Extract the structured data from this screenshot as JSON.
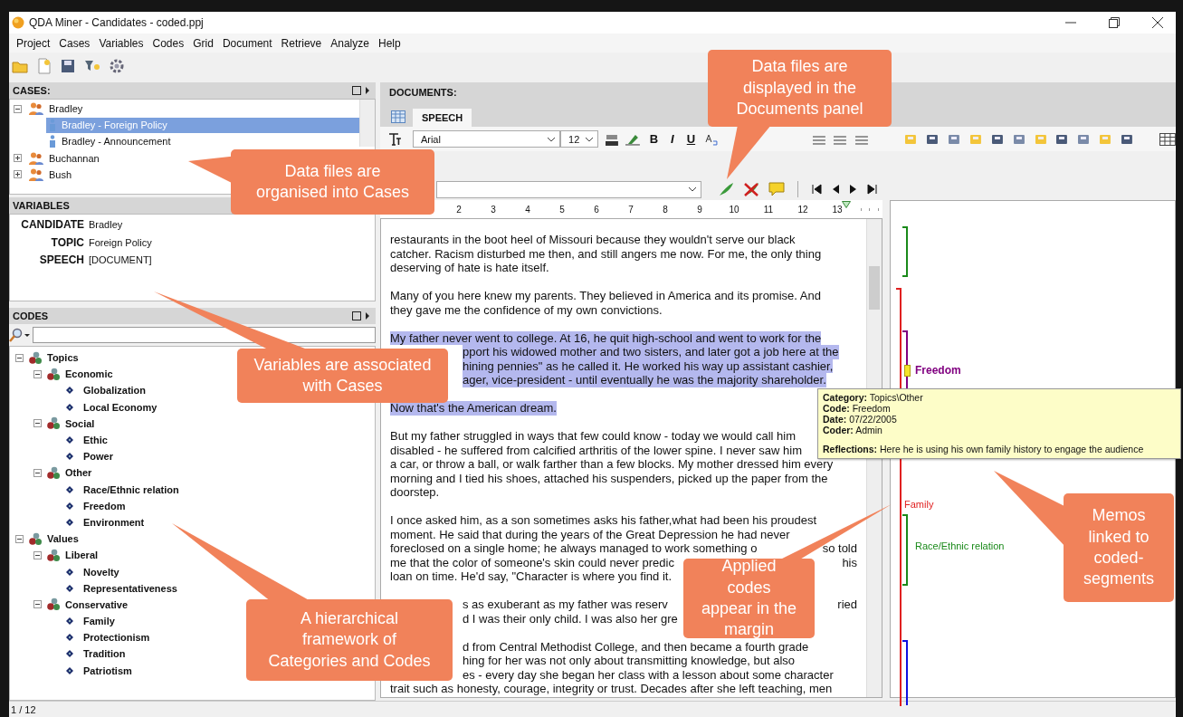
{
  "window": {
    "title": "QDA Miner - Candidates - coded.ppj"
  },
  "menu": [
    "Project",
    "Cases",
    "Variables",
    "Codes",
    "Grid",
    "Document",
    "Retrieve",
    "Analyze",
    "Help"
  ],
  "cases": {
    "title": "CASES:",
    "items": [
      {
        "label": "Bradley",
        "kind": "group",
        "expanded": true,
        "selected": false,
        "children": [
          {
            "label": "Bradley - Foreign Policy",
            "kind": "case",
            "selected": true
          },
          {
            "label": "Bradley - Announcement",
            "kind": "case",
            "selected": false
          }
        ]
      },
      {
        "label": "Buchannan",
        "kind": "group",
        "expanded": false,
        "selected": false
      },
      {
        "label": "Bush",
        "kind": "group",
        "expanded": false,
        "selected": false
      }
    ]
  },
  "variables": {
    "title": "VARIABLES",
    "rows": [
      {
        "name": "CANDIDATE",
        "value": "Bradley"
      },
      {
        "name": "TOPIC",
        "value": "Foreign Policy"
      },
      {
        "name": "SPEECH",
        "value": "[DOCUMENT]"
      }
    ]
  },
  "codes": {
    "title": "CODES",
    "items": [
      {
        "label": "Topics",
        "kind": "category",
        "expanded": true,
        "children": [
          {
            "label": "Economic",
            "kind": "category",
            "expanded": true,
            "children": [
              {
                "label": "Globalization",
                "kind": "code"
              },
              {
                "label": "Local Economy",
                "kind": "code"
              }
            ]
          },
          {
            "label": "Social",
            "kind": "category",
            "expanded": true,
            "children": [
              {
                "label": "Ethic",
                "kind": "code"
              },
              {
                "label": "Power",
                "kind": "code"
              }
            ]
          },
          {
            "label": "Other",
            "kind": "category",
            "expanded": true,
            "children": [
              {
                "label": "Race/Ethnic relation",
                "kind": "code"
              },
              {
                "label": "Freedom",
                "kind": "code"
              },
              {
                "label": "Environment",
                "kind": "code"
              }
            ]
          }
        ]
      },
      {
        "label": "Values",
        "kind": "category",
        "expanded": true,
        "children": [
          {
            "label": "Liberal",
            "kind": "category",
            "expanded": true,
            "children": [
              {
                "label": "Novelty",
                "kind": "code"
              },
              {
                "label": "Representativeness",
                "kind": "code"
              }
            ]
          },
          {
            "label": "Conservative",
            "kind": "category",
            "expanded": true,
            "children": [
              {
                "label": "Family",
                "kind": "code"
              },
              {
                "label": "Protectionism",
                "kind": "code"
              },
              {
                "label": "Tradition",
                "kind": "code"
              },
              {
                "label": "Patriotism",
                "kind": "code"
              }
            ]
          }
        ]
      }
    ]
  },
  "documents": {
    "title": "DOCUMENTS:",
    "tabs": [
      {
        "label": "SPEECH",
        "selected": true
      }
    ],
    "font": "Arial",
    "size": "12",
    "format_buttons": [
      "B",
      "I",
      "U"
    ],
    "ruler": [
      "2",
      "3",
      "4",
      "5",
      "6",
      "7",
      "8",
      "9",
      "10",
      "11",
      "12",
      "13"
    ],
    "paragraphs": [
      {
        "highlighted": false,
        "lines": [
          {
            "kind": "full",
            "parts": [
              "restaurants in the boot heel of Missouri because they wouldn't serve our black"
            ]
          },
          {
            "kind": "full",
            "parts": [
              "catcher. Racism disturbed me then, and still angers me now. For me, the only thing"
            ]
          },
          {
            "kind": "full",
            "parts": [
              "deserving of hate is hate itself."
            ]
          }
        ]
      },
      {
        "highlighted": false,
        "lines": [
          {
            "kind": "full",
            "parts": [
              "Many of you here knew my parents. They believed in America and its promise. And"
            ]
          },
          {
            "kind": "full",
            "parts": [
              "they gave me the confidence of my own convictions."
            ]
          }
        ]
      },
      {
        "highlighted": true,
        "lines": [
          {
            "kind": "full",
            "parts": [
              "My father never went to college. At 16, he quit high-school and went to work for the"
            ]
          },
          {
            "kind": "covered_left",
            "parts": [
              "pport his widowed mother and two sisters, and later got a job here at the"
            ]
          },
          {
            "kind": "covered_left",
            "parts": [
              "hining pennies\" as he called it. He worked his way up assistant cashier,"
            ]
          },
          {
            "kind": "covered_left",
            "parts": [
              "ager, vice-president - until eventually he was the majority shareholder."
            ]
          }
        ]
      },
      {
        "highlighted": true,
        "lines": [
          {
            "kind": "full",
            "parts": [
              "Now that's the American dream."
            ]
          }
        ]
      },
      {
        "highlighted": false,
        "lines": [
          {
            "kind": "full",
            "parts": [
              "But my father struggled in ways that few could know -  today we would call him"
            ]
          },
          {
            "kind": "full",
            "parts": [
              "disabled - he suffered from calcified arthritis of the lower spine. I never saw him"
            ]
          },
          {
            "kind": "full",
            "parts": [
              "a car, or throw a ball, or walk farther than a few blocks. My mother dressed him every"
            ]
          },
          {
            "kind": "full",
            "parts": [
              "morning and I tied his shoes, attached his suspenders, picked up the paper from the"
            ]
          },
          {
            "kind": "full",
            "parts": [
              "doorstep."
            ]
          }
        ]
      },
      {
        "highlighted": false,
        "lines": [
          {
            "kind": "full",
            "parts": [
              "I once asked him, as a son sometimes asks his father,what had been his proudest"
            ]
          },
          {
            "kind": "full",
            "parts": [
              "moment. He said that during the years of the Great Depression he had never"
            ]
          },
          {
            "kind": "covered_mid",
            "parts": [
              "foreclosed on a single home; he always managed to work something o",
              "so told"
            ]
          },
          {
            "kind": "covered_mid",
            "parts": [
              "me that the color of someone's skin could never predic",
              "his"
            ]
          },
          {
            "kind": "full",
            "parts": [
              "loan on time. He'd say, \"Character is where you find it."
            ]
          }
        ]
      },
      {
        "highlighted": false,
        "lines": [
          {
            "kind": "covered_both",
            "parts": [
              "s as exuberant as my father was reserv",
              "ried"
            ]
          },
          {
            "kind": "covered_left",
            "parts": [
              "d I was their only child. I was also her gre"
            ]
          }
        ]
      },
      {
        "highlighted": false,
        "lines": [
          {
            "kind": "covered_left",
            "parts": [
              "d from Central Methodist College, and then became a fourth grade"
            ]
          },
          {
            "kind": "covered_left",
            "parts": [
              "hing for her was not only about transmitting knowledge, but also"
            ]
          },
          {
            "kind": "covered_left",
            "parts": [
              "es - every day she began her class with a lesson about some character"
            ]
          },
          {
            "kind": "full",
            "parts": [
              "trait such as honesty, courage, integrity or trust. Decades after she left teaching, men"
            ]
          }
        ]
      }
    ]
  },
  "margin": {
    "codes": [
      {
        "color": "#1a8a1a"
      },
      {
        "label": "Freedom",
        "color": "#800080",
        "memo": true
      },
      {
        "label": "Family",
        "color": "#e02020"
      },
      {
        "label": "Race/Ethnic relation",
        "color": "#1a8a1a"
      },
      {
        "color": "#1010e0"
      }
    ]
  },
  "tooltip": {
    "fields": [
      {
        "label": "Category:",
        "value": "Topics\\Other"
      },
      {
        "label": "Code:",
        "value": "Freedom"
      },
      {
        "label": "Date:",
        "value": "07/22/2005"
      },
      {
        "label": "Coder:",
        "value": "Admin"
      }
    ],
    "reflections": {
      "label": "Reflections:",
      "value": "Here he is using his own family history to engage the audience"
    }
  },
  "callouts": [
    {
      "text": "Data files are displayed in the Documents panel"
    },
    {
      "text": "Data files are organised into Cases"
    },
    {
      "text": "Variables are associated with Cases"
    },
    {
      "text": "A hierarchical framework of Categories and Codes"
    },
    {
      "text": "Applied codes appear in the margin"
    },
    {
      "text": "Memos linked to coded-segments"
    }
  ],
  "status_bar": {
    "position": "1 / 12"
  }
}
